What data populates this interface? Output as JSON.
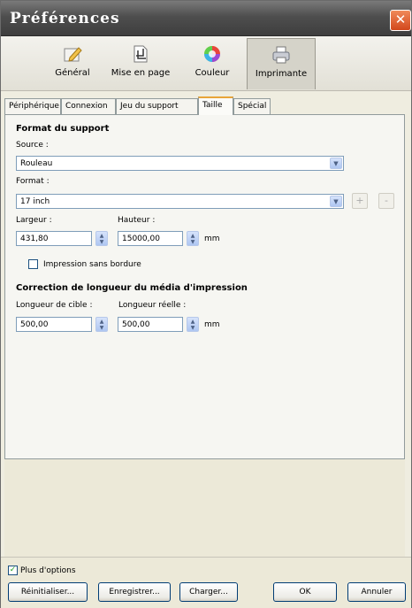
{
  "window": {
    "title": "Préférences",
    "close_glyph": "✕"
  },
  "toolbar": {
    "items": [
      {
        "label": "Général",
        "icon": "pencil-icon"
      },
      {
        "label": "Mise en page",
        "icon": "crop-page-icon"
      },
      {
        "label": "Couleur",
        "icon": "color-wheel-icon"
      },
      {
        "label": "Imprimante",
        "icon": "printer-icon"
      }
    ],
    "active": "Imprimante"
  },
  "tabs": [
    {
      "label": "Périphérique"
    },
    {
      "label": "Connexion"
    },
    {
      "label": "Jeu du support"
    },
    {
      "label": "Taille"
    },
    {
      "label": "Spécial"
    }
  ],
  "selected_tab": "Taille",
  "support": {
    "heading": "Format du support",
    "source_label": "Source :",
    "source_value": "Rouleau",
    "format_label": "Format :",
    "format_value": "17 inch",
    "add_glyph": "+",
    "remove_glyph": "-",
    "width_label": "Largeur :",
    "width_value": "431,80",
    "height_label": "Hauteur :",
    "height_value": "15000,00",
    "unit": "mm",
    "borderless_label": "Impression sans bordure",
    "borderless_checked": false
  },
  "correction": {
    "heading": "Correction de longueur du média d'impression",
    "target_label": "Longueur de cible :",
    "target_value": "500,00",
    "actual_label": "Longueur réelle :",
    "actual_value": "500,00",
    "unit": "mm"
  },
  "footer": {
    "more_options_label": "Plus d'options",
    "more_options_checked": true,
    "check_glyph": "✓",
    "reset_label": "Réinitialiser...",
    "save_label": "Enregistrer...",
    "load_label": "Charger...",
    "ok_label": "OK",
    "cancel_label": "Annuler"
  },
  "colors": {
    "title_bar": "#4e4e4e",
    "close_button": "#d2471c",
    "tab_highlight": "#e8a53a",
    "field_border": "#7f9db9"
  }
}
